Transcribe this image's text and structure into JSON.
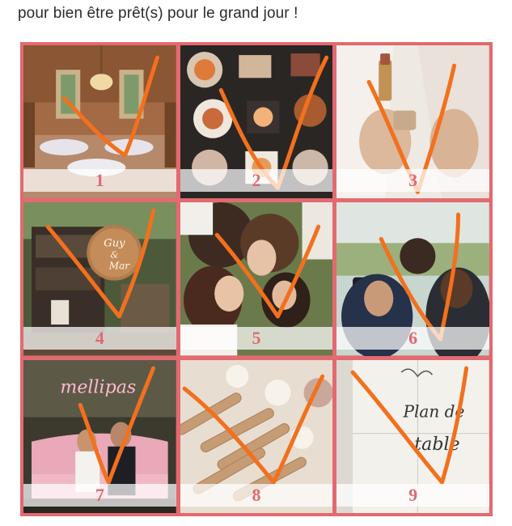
{
  "caption": "pour bien être prêt(s) pour le grand jour !",
  "colors": {
    "frame": "#e26a70",
    "number": "#e06a72",
    "checkmark": "#f2701e"
  },
  "tiles": [
    {
      "number": "1",
      "subject": "chandelier-reception-hall-photo",
      "checked": true
    },
    {
      "number": "2",
      "subject": "catering-appetizers-photo",
      "checked": true
    },
    {
      "number": "3",
      "subject": "lipstick-beauty-photo",
      "checked": true
    },
    {
      "number": "4",
      "subject": "wooden-welcome-sign-photo",
      "checked": true,
      "sign_text": [
        "Guy",
        "&",
        "Mar"
      ]
    },
    {
      "number": "5",
      "subject": "women-lying-on-grass-photo",
      "checked": true
    },
    {
      "number": "6",
      "subject": "photographer-with-camera-photo",
      "checked": true
    },
    {
      "number": "7",
      "subject": "couple-on-pink-sofa-photo",
      "checked": true,
      "neon_text": "mellipas"
    },
    {
      "number": "8",
      "subject": "guest-favor-tubes-photo",
      "checked": true
    },
    {
      "number": "9",
      "subject": "seating-plan-board-photo",
      "checked": true,
      "board_text": [
        "Plan de",
        "table"
      ]
    }
  ]
}
